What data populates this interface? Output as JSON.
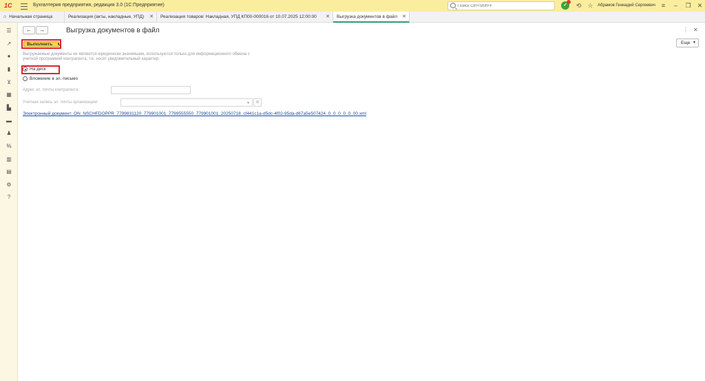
{
  "titlebar": {
    "logo": "1С",
    "app_title": "Бухгалтерия предприятия, редакция 3.0  (1С:Предприятие)",
    "search_placeholder": "Поиск Ctrl+Shift+F",
    "notification_count": "1",
    "user_name": "Абрамов Геннадий Сергеевич"
  },
  "tabs": [
    {
      "label": "Начальная страница"
    },
    {
      "label": "Реализация (акты, накладные, УПД)"
    },
    {
      "label": "Реализация товаров: Накладная, УПД КП00-000016 от 10.07.2025 12:00:00"
    },
    {
      "label": "Выгрузка документов в файл"
    }
  ],
  "form": {
    "title": "Выгрузка документов в файл",
    "execute_label": "Выполнить",
    "more_label": "Еще",
    "note": "Выгружаемые документы не являются юридически значимыми, используются только для информационного обмена с учетной программой контрагента, т.е. носят уведомительный характер.",
    "option_disk": "На диск",
    "option_email": "Вложение в эл. письмо",
    "email_address_label": "Адрес эл. почты контрагента:",
    "email_account_label": "Учетная запись эл. почты организации:",
    "document_link": "Электронный документ: ON_NSCHFDOPPR_7799831120_779901001_7799555550_779901001_20250718_cf441c1a-d5dc-4f02-95da-d67a5e507424_0_0_0_0_0_00.xml"
  }
}
